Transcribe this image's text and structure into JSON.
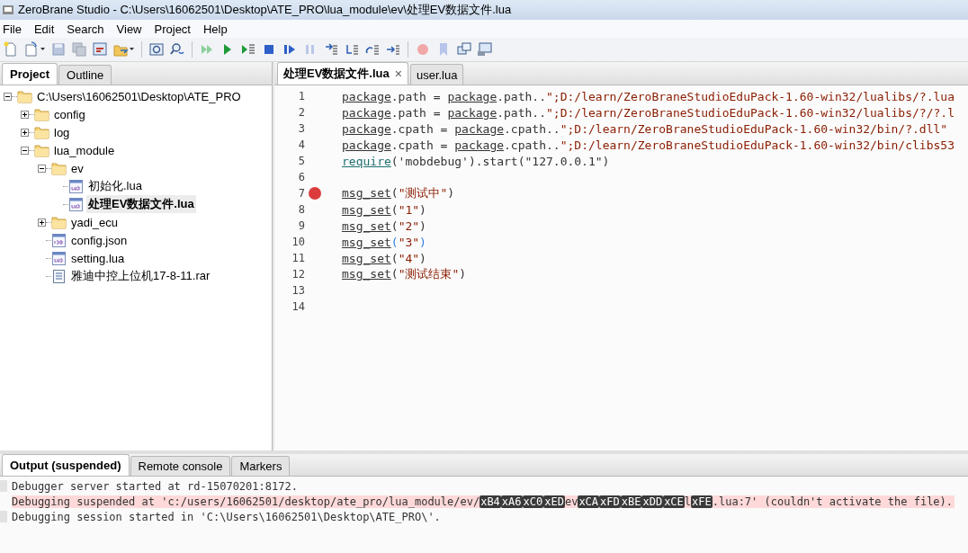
{
  "window": {
    "title": "ZeroBrane Studio - C:\\Users\\16062501\\Desktop\\ATE_PRO\\lua_module\\ev\\处理EV数据文件.lua"
  },
  "menu": [
    "File",
    "Edit",
    "Search",
    "View",
    "Project",
    "Help"
  ],
  "left_tabs": [
    {
      "label": "Project",
      "selected": true
    },
    {
      "label": "Outline",
      "selected": false
    }
  ],
  "tree": [
    {
      "label": "C:\\Users\\16062501\\Desktop\\ATE_PRO",
      "kind": "folder",
      "expanded": true,
      "selected": false,
      "children": [
        {
          "label": "config",
          "kind": "folder",
          "expanded": false,
          "selected": false
        },
        {
          "label": "log",
          "kind": "folder",
          "expanded": false,
          "selected": false
        },
        {
          "label": "lua_module",
          "kind": "folder",
          "expanded": true,
          "selected": false,
          "children": [
            {
              "label": "ev",
              "kind": "folder",
              "expanded": true,
              "selected": false,
              "children": [
                {
                  "label": "初始化.lua",
                  "kind": "lua",
                  "selected": false
                },
                {
                  "label": "处理EV数据文件.lua",
                  "kind": "lua",
                  "selected": true
                }
              ]
            },
            {
              "label": "yadi_ecu",
              "kind": "folder",
              "expanded": false,
              "selected": false
            },
            {
              "label": "config.json",
              "kind": "json",
              "selected": false
            },
            {
              "label": "setting.lua",
              "kind": "lua",
              "selected": false
            },
            {
              "label": "雅迪中控上位机17-8-11.rar",
              "kind": "file",
              "selected": false
            }
          ]
        }
      ]
    }
  ],
  "editor_tabs": [
    {
      "label": "处理EV数据文件.lua",
      "selected": true,
      "close": "×"
    },
    {
      "label": "user.lua",
      "selected": false
    }
  ],
  "code": [
    {
      "number": "1",
      "breakpoint": false,
      "tokens": [
        {
          "kind": "global",
          "text": "package"
        },
        {
          "kind": "text",
          "text": ".path = "
        },
        {
          "kind": "global",
          "text": "package"
        },
        {
          "kind": "text",
          "text": ".path.."
        },
        {
          "kind": "string",
          "text": "\";D:/learn/ZeroBraneStudioEduPack-1.60-win32/lualibs/?.lua"
        }
      ]
    },
    {
      "number": "2",
      "breakpoint": false,
      "tokens": [
        {
          "kind": "global",
          "text": "package"
        },
        {
          "kind": "text",
          "text": ".path = "
        },
        {
          "kind": "global",
          "text": "package"
        },
        {
          "kind": "text",
          "text": ".path.."
        },
        {
          "kind": "string",
          "text": "\";D:/learn/ZeroBraneStudioEduPack-1.60-win32/lualibs/?/?.l"
        }
      ]
    },
    {
      "number": "3",
      "breakpoint": false,
      "tokens": [
        {
          "kind": "global",
          "text": "package"
        },
        {
          "kind": "text",
          "text": ".cpath = "
        },
        {
          "kind": "global",
          "text": "package"
        },
        {
          "kind": "text",
          "text": ".cpath.."
        },
        {
          "kind": "string",
          "text": "\";D:/learn/ZeroBraneStudioEduPack-1.60-win32/bin/?.dll\""
        }
      ]
    },
    {
      "number": "4",
      "breakpoint": false,
      "tokens": [
        {
          "kind": "global",
          "text": "package"
        },
        {
          "kind": "text",
          "text": ".cpath = "
        },
        {
          "kind": "global",
          "text": "package"
        },
        {
          "kind": "text",
          "text": ".cpath.."
        },
        {
          "kind": "string",
          "text": "\";D:/learn/ZeroBraneStudioEduPack-1.60-win32/bin/clibs53"
        }
      ]
    },
    {
      "number": "5",
      "breakpoint": false,
      "tokens": [
        {
          "kind": "builtin",
          "text": "require"
        },
        {
          "kind": "text",
          "text": "('mobdebug').start(\"127.0.0.1\")"
        }
      ]
    },
    {
      "number": "6",
      "breakpoint": false
    },
    {
      "number": "7",
      "breakpoint": true,
      "tokens": [
        {
          "kind": "global",
          "text": "msg_set"
        },
        {
          "kind": "text",
          "text": "("
        },
        {
          "kind": "string",
          "text": "\"测试中\""
        },
        {
          "kind": "text",
          "text": ")"
        }
      ]
    },
    {
      "number": "8",
      "breakpoint": false,
      "tokens": [
        {
          "kind": "global",
          "text": "msg_set"
        },
        {
          "kind": "text",
          "text": "("
        },
        {
          "kind": "string",
          "text": "\"1\""
        },
        {
          "kind": "text",
          "text": ")"
        }
      ]
    },
    {
      "number": "9",
      "breakpoint": false,
      "tokens": [
        {
          "kind": "global",
          "text": "msg_set"
        },
        {
          "kind": "text",
          "text": "("
        },
        {
          "kind": "string",
          "text": "\"2\""
        },
        {
          "kind": "text",
          "text": ")"
        }
      ]
    },
    {
      "number": "10",
      "breakpoint": false,
      "tokens": [
        {
          "kind": "global",
          "text": "msg_set"
        },
        {
          "kind": "brace",
          "text": "("
        },
        {
          "kind": "string",
          "text": "\"3\""
        },
        {
          "kind": "brace",
          "text": ")"
        }
      ]
    },
    {
      "number": "11",
      "breakpoint": false,
      "tokens": [
        {
          "kind": "global",
          "text": "msg_set"
        },
        {
          "kind": "text",
          "text": "("
        },
        {
          "kind": "string",
          "text": "\"4\""
        },
        {
          "kind": "text",
          "text": ")"
        }
      ]
    },
    {
      "number": "12",
      "breakpoint": false,
      "tokens": [
        {
          "kind": "global",
          "text": "msg_set"
        },
        {
          "kind": "text",
          "text": "("
        },
        {
          "kind": "string",
          "text": "\"测试结束\""
        },
        {
          "kind": "text",
          "text": ")"
        }
      ]
    },
    {
      "number": "13",
      "breakpoint": false
    },
    {
      "number": "14",
      "breakpoint": false
    }
  ],
  "bottom_tabs": [
    {
      "label": "Output (suspended)",
      "selected": true
    },
    {
      "label": "Remote console",
      "selected": false
    },
    {
      "label": "Markers",
      "selected": false
    }
  ],
  "output": [
    {
      "kind": "info",
      "tokens": [
        {
          "kind": "text",
          "text": "Debugger server started at rd-15070201:8172."
        }
      ]
    },
    {
      "kind": "error",
      "tokens": [
        {
          "kind": "text",
          "text": "Debugging suspended at 'c:/users/16062501/desktop/ate_pro/lua_module/ev/"
        },
        {
          "kind": "byte",
          "text": "xB4"
        },
        {
          "kind": "byte",
          "text": "xA6"
        },
        {
          "kind": "byte",
          "text": "xC0"
        },
        {
          "kind": "byte",
          "text": "xED"
        },
        {
          "kind": "text",
          "text": "ev"
        },
        {
          "kind": "byte",
          "text": "xCA"
        },
        {
          "kind": "byte",
          "text": "xFD"
        },
        {
          "kind": "byte",
          "text": "xBE"
        },
        {
          "kind": "byte",
          "text": "xDD"
        },
        {
          "kind": "byte",
          "text": "xCE"
        },
        {
          "kind": "text",
          "text": "l"
        },
        {
          "kind": "byte",
          "text": "xFE"
        },
        {
          "kind": "text",
          "text": ".lua:7' (couldn't activate the file)."
        }
      ]
    },
    {
      "kind": "info",
      "tokens": [
        {
          "kind": "text",
          "text": "Debugging session started in 'C:\\Users\\16062501\\Desktop\\ATE_PRO\\'."
        }
      ]
    }
  ]
}
